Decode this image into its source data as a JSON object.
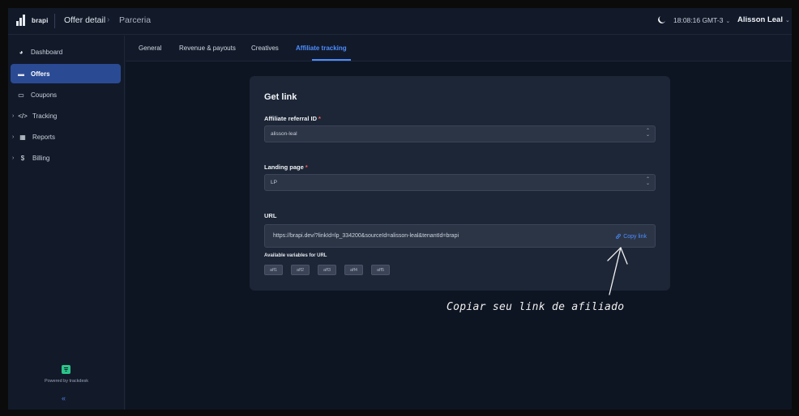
{
  "header": {
    "logo_text": "brapi",
    "breadcrumb_1": "Offer detail",
    "breadcrumb_sep": "›",
    "breadcrumb_2": "Parceria",
    "time": "18:08:16 GMT-3",
    "user": "Alisson Leal",
    "chevron": "⌄"
  },
  "sidebar": {
    "items": [
      {
        "label": "Dashboard",
        "icon": "pie-chart-icon",
        "glyph": "◕"
      },
      {
        "label": "Offers",
        "icon": "offers-icon",
        "glyph": "▬"
      },
      {
        "label": "Coupons",
        "icon": "coupon-icon",
        "glyph": "▭"
      },
      {
        "label": "Tracking",
        "icon": "code-icon",
        "glyph": "</>"
      },
      {
        "label": "Reports",
        "icon": "reports-icon",
        "glyph": "▦"
      },
      {
        "label": "Billing",
        "icon": "dollar-icon",
        "glyph": "$"
      }
    ],
    "expander": "›",
    "powered_by": "Powered by trackdesk",
    "collapse": "«"
  },
  "tabs": [
    {
      "label": "General"
    },
    {
      "label": "Revenue & payouts"
    },
    {
      "label": "Creatives"
    },
    {
      "label": "Affiliate tracking"
    }
  ],
  "card": {
    "title": "Get link",
    "affiliate_label": "Affiliate referral ID",
    "affiliate_value": "alisson-leal",
    "landing_label": "Landing page",
    "landing_value": "LP",
    "required_mark": "*",
    "url_label": "URL",
    "url_value": "https://brapi.dev/?linkId=lp_334200&sourceId=alisson-leal&tenantId=brapi",
    "copy_label": "Copy link",
    "vars_label": "Available variables for URL",
    "variables": [
      "aff1",
      "aff2",
      "aff3",
      "aff4",
      "aff5"
    ],
    "select_arrows": "⌃⌄"
  },
  "annotation": "Copiar seu link de afiliado",
  "colors": {
    "accent": "#4d8dff",
    "active_nav": "#2a4a94",
    "card_bg": "#1d2636"
  }
}
